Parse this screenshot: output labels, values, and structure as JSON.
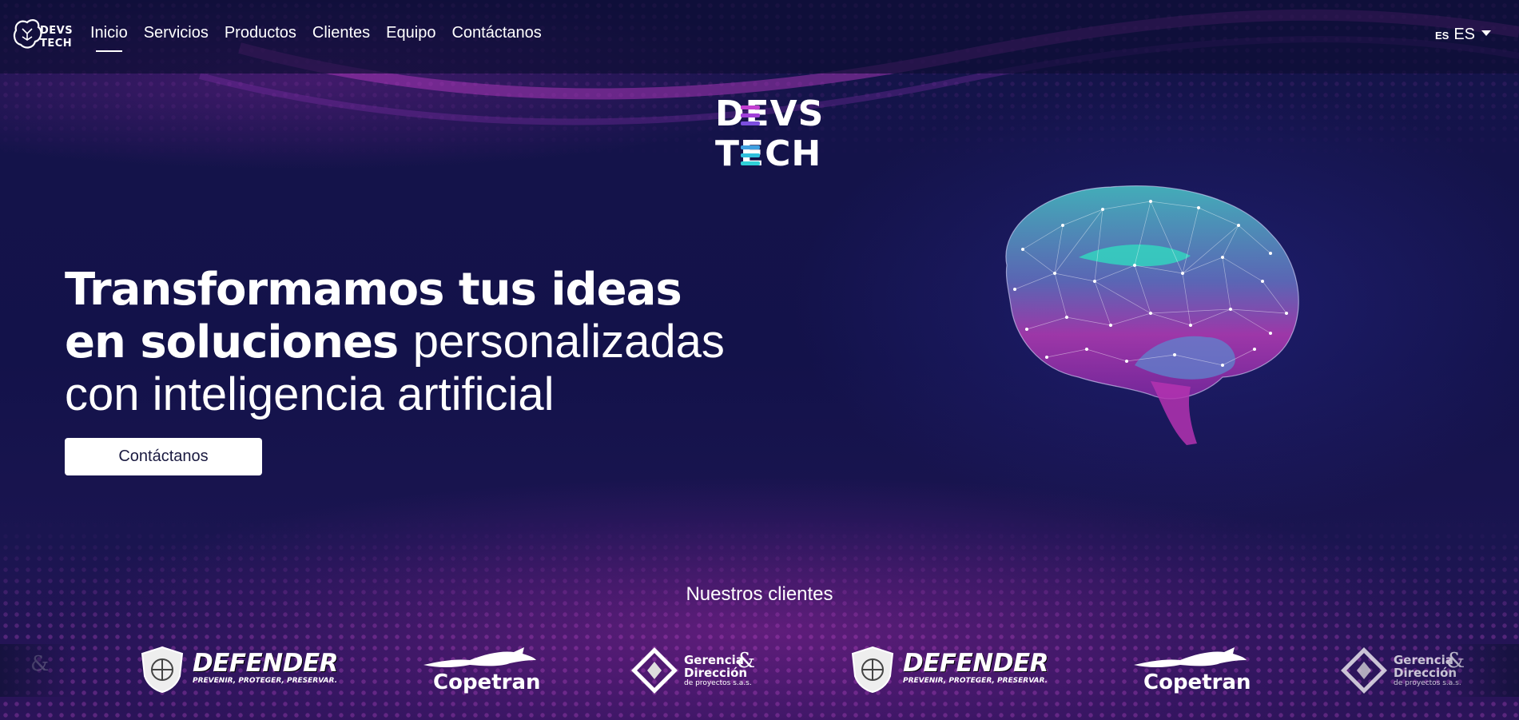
{
  "nav": {
    "brand": "DEVS TECH",
    "links": [
      {
        "label": "Inicio",
        "active": true
      },
      {
        "label": "Servicios"
      },
      {
        "label": "Productos"
      },
      {
        "label": "Clientes"
      },
      {
        "label": "Equipo"
      },
      {
        "label": "Contáctanos"
      }
    ],
    "language": {
      "code_small": "ES",
      "label": "ES"
    }
  },
  "hero": {
    "logo_line1": "DEVS",
    "logo_line2": "TECH",
    "title_bold_1": "Transformamos tus ideas",
    "title_bold_2": "en soluciones",
    "title_light_2": "personalizadas",
    "title_light_3": "con inteligencia artificial",
    "cta_label": "Contáctanos",
    "logo_bar_colors": [
      "#c23fd0",
      "#7c4fe0",
      "#2fd0d8"
    ]
  },
  "clients": {
    "title": "Nuestros clientes",
    "logos": [
      {
        "name": "DEFENDER",
        "tagline": "PREVENIR, PROTEGER, PRESERVAR."
      },
      {
        "name": "Copetran"
      },
      {
        "name_line1": "Gerencia",
        "name_line2": "Dirección",
        "amp": "&",
        "sub": "de proyectos s.a.s."
      },
      {
        "name": "DEFENDER",
        "tagline": "PREVENIR, PROTEGER, PRESERVAR."
      },
      {
        "name": "Copetran"
      },
      {
        "name_line1": "Gerencia",
        "name_line2": "Dirección",
        "amp": "&",
        "sub": "de proyectos s.a.s."
      }
    ]
  },
  "colors": {
    "background": "#15144a",
    "accent_pink": "#c23fd0",
    "accent_cyan": "#2fd0d8"
  }
}
